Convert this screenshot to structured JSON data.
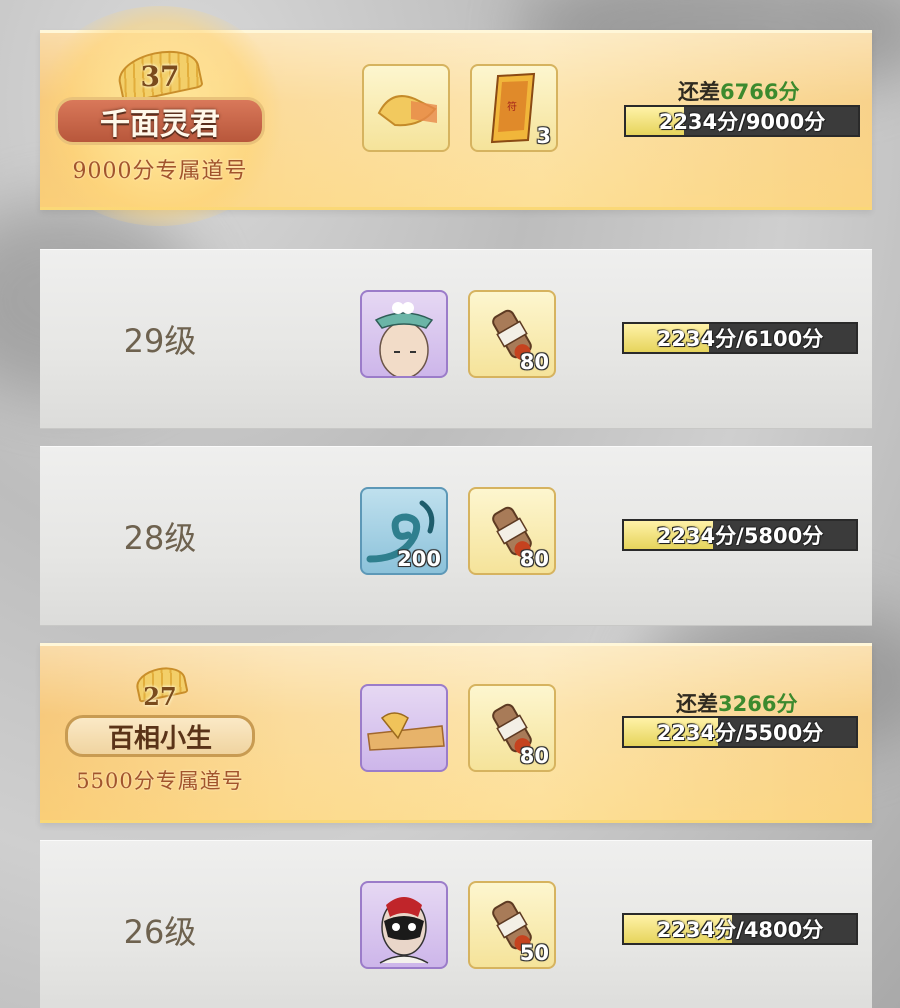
{
  "rows": [
    {
      "type": "title",
      "title_level": "37",
      "title_name": "千面灵君",
      "title_sub": "9000分专属道号",
      "items": [
        {
          "icon": "golden-fan",
          "count": ""
        },
        {
          "icon": "yellow-talisman",
          "count": "3"
        }
      ],
      "diff_prefix": "还差",
      "diff_value": "6766",
      "diff_unit": "分",
      "progress_text": "2234分/9000分",
      "progress_fraction": 0.248
    },
    {
      "type": "level",
      "level_label": "29级",
      "items": [
        {
          "icon": "monk-head-with-bowl",
          "count": ""
        },
        {
          "icon": "scroll-bottle",
          "count": "80"
        }
      ],
      "progress_text": "2234分/6100分",
      "progress_fraction": 0.366
    },
    {
      "type": "level",
      "level_label": "28级",
      "items": [
        {
          "icon": "wave-swirl",
          "count": "200"
        },
        {
          "icon": "scroll-bottle",
          "count": "80"
        }
      ],
      "progress_text": "2234分/5800分",
      "progress_fraction": 0.385
    },
    {
      "type": "title",
      "title_level": "27",
      "title_name": "百相小生",
      "title_sub": "5500分专属道号",
      "items": [
        {
          "icon": "folded-fan",
          "count": ""
        },
        {
          "icon": "scroll-bottle",
          "count": "80"
        }
      ],
      "diff_prefix": "还差",
      "diff_value": "3266",
      "diff_unit": "分",
      "progress_text": "2234分/5500分",
      "progress_fraction": 0.406
    },
    {
      "type": "level",
      "level_label": "26级",
      "items": [
        {
          "icon": "opera-mask-face",
          "count": ""
        },
        {
          "icon": "scroll-bottle",
          "count": "50"
        }
      ],
      "progress_text": "2234分/4800分",
      "progress_fraction": 0.465
    }
  ]
}
